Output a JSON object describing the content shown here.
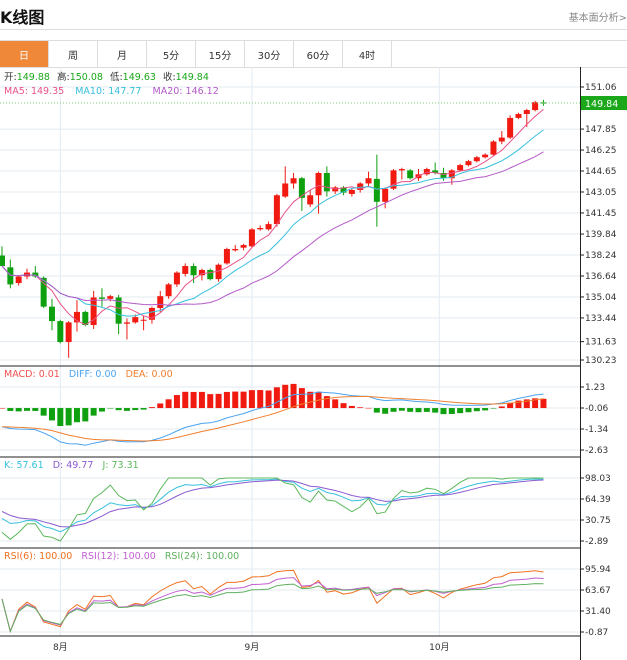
{
  "header": {
    "title": "K线图",
    "fundamental_link": "基本面分析>"
  },
  "tabs": [
    {
      "label": "日",
      "active": true
    },
    {
      "label": "周"
    },
    {
      "label": "月"
    },
    {
      "label": "5分"
    },
    {
      "label": "15分"
    },
    {
      "label": "30分"
    },
    {
      "label": "60分"
    },
    {
      "label": "4时"
    }
  ],
  "ohlc_info": {
    "open_label": "开:",
    "open": "149.88",
    "high_label": "高:",
    "high": "150.08",
    "low_label": "低:",
    "low": "149.63",
    "close_label": "收:",
    "close": "149.84"
  },
  "ma_info": {
    "ma5": "MA5: 149.35",
    "ma10": "MA10: 147.77",
    "ma20": "MA20: 146.12"
  },
  "macd_info": {
    "macd": "MACD: 0.01",
    "diff": "DIFF: 0.00",
    "dea": "DEA: 0.00"
  },
  "kdj_info": {
    "k": "K: 57.61",
    "d": "D: 49.77",
    "j": "J: 73.31"
  },
  "rsi_info": {
    "rsi6": "RSI(6): 100.00",
    "rsi12": "RSI(12): 100.00",
    "rsi24": "RSI(24): 100.00"
  },
  "current_price": "149.84",
  "colors": {
    "up": "#f01a10",
    "down": "#0fa010",
    "accent": "#f0883a",
    "ma5": "#e8528a",
    "ma10": "#37c0dc",
    "ma20": "#b45ac8",
    "diff": "#4aa3f0",
    "dea": "#f08030",
    "macd": "#f05050",
    "k": "#37c0dc",
    "d": "#8a5ad0",
    "j": "#5cb85c",
    "rsi6": "#f07020",
    "rsi12": "#c060d0",
    "rsi24": "#60b060"
  },
  "axes": {
    "price_ticks": [
      "151.06",
      "147.85",
      "146.25",
      "144.65",
      "143.05",
      "141.45",
      "139.84",
      "138.24",
      "136.64",
      "135.04",
      "133.44",
      "131.63",
      "130.23"
    ],
    "price_range": [
      130.23,
      151.06
    ],
    "macd_ticks": [
      "1.23",
      "-0.06",
      "-1.34",
      "-2.63"
    ],
    "macd_range": [
      -2.63,
      1.23
    ],
    "kdj_ticks": [
      "98.03",
      "64.39",
      "30.75",
      "-2.89"
    ],
    "kdj_range": [
      -2.89,
      98.03
    ],
    "rsi_ticks": [
      "95.94",
      "63.67",
      "31.40",
      "-0.87"
    ],
    "rsi_range": [
      -0.87,
      95.94
    ],
    "months": [
      {
        "label": "8月",
        "index": 7
      },
      {
        "label": "9月",
        "index": 30
      },
      {
        "label": "10月",
        "index": 52.5
      }
    ]
  },
  "chart_data": {
    "type": "candlestick",
    "ohlc": [
      [
        138.2,
        138.9,
        137.4,
        137.4
      ],
      [
        137.3,
        137.9,
        135.7,
        136.0
      ],
      [
        136.1,
        136.7,
        135.9,
        136.6
      ],
      [
        136.6,
        137.2,
        136.4,
        136.9
      ],
      [
        136.9,
        137.4,
        136.5,
        136.6
      ],
      [
        136.5,
        136.6,
        134.2,
        134.3
      ],
      [
        134.3,
        134.9,
        132.5,
        133.2
      ],
      [
        133.2,
        133.3,
        131.5,
        131.6
      ],
      [
        131.6,
        133.2,
        130.4,
        133.1
      ],
      [
        133.1,
        134.8,
        132.4,
        133.9
      ],
      [
        133.9,
        134.0,
        132.8,
        132.9
      ],
      [
        132.9,
        135.5,
        132.6,
        135.0
      ],
      [
        135.0,
        135.7,
        134.3,
        134.9
      ],
      [
        134.9,
        135.2,
        134.7,
        135.1
      ],
      [
        135.0,
        135.2,
        132.2,
        133.0
      ],
      [
        133.0,
        133.4,
        131.8,
        133.1
      ],
      [
        133.1,
        133.7,
        133.0,
        133.5
      ],
      [
        133.3,
        133.6,
        132.5,
        133.3
      ],
      [
        133.3,
        134.3,
        133.0,
        134.2
      ],
      [
        134.2,
        135.5,
        133.9,
        135.1
      ],
      [
        135.1,
        136.1,
        134.9,
        136.0
      ],
      [
        136.0,
        137.0,
        135.8,
        136.9
      ],
      [
        136.8,
        137.6,
        136.6,
        137.4
      ],
      [
        137.4,
        137.6,
        136.1,
        136.7
      ],
      [
        136.7,
        137.2,
        136.3,
        137.1
      ],
      [
        137.1,
        137.2,
        136.3,
        136.4
      ],
      [
        136.4,
        137.6,
        136.2,
        137.5
      ],
      [
        137.6,
        138.8,
        137.5,
        138.7
      ],
      [
        138.6,
        139.0,
        138.5,
        138.7
      ],
      [
        138.8,
        139.1,
        138.6,
        139.0
      ],
      [
        138.9,
        140.3,
        138.8,
        140.2
      ],
      [
        140.2,
        140.5,
        140.1,
        140.3
      ],
      [
        140.2,
        140.8,
        140.1,
        140.6
      ],
      [
        140.6,
        142.9,
        140.4,
        142.8
      ],
      [
        142.7,
        145.0,
        142.6,
        143.7
      ],
      [
        143.7,
        144.5,
        143.3,
        144.1
      ],
      [
        144.1,
        144.2,
        141.6,
        142.6
      ],
      [
        142.1,
        143.2,
        141.9,
        142.8
      ],
      [
        142.8,
        144.6,
        141.4,
        144.5
      ],
      [
        144.5,
        145.0,
        142.7,
        143.1
      ],
      [
        143.1,
        143.5,
        142.9,
        143.4
      ],
      [
        143.4,
        143.5,
        142.8,
        143.0
      ],
      [
        142.9,
        143.3,
        142.7,
        143.2
      ],
      [
        143.2,
        143.8,
        143.0,
        143.7
      ],
      [
        143.7,
        144.6,
        143.5,
        144.1
      ],
      [
        144.05,
        145.9,
        140.4,
        142.3
      ],
      [
        142.3,
        143.4,
        141.8,
        143.3
      ],
      [
        143.3,
        144.8,
        143.2,
        144.7
      ],
      [
        144.7,
        144.9,
        144.0,
        144.8
      ],
      [
        144.7,
        144.8,
        144.0,
        144.1
      ],
      [
        144.1,
        144.8,
        143.9,
        144.4
      ],
      [
        144.4,
        144.9,
        144.3,
        144.8
      ],
      [
        144.7,
        145.3,
        144.4,
        144.5
      ],
      [
        144.5,
        144.9,
        143.9,
        144.1
      ],
      [
        144.1,
        144.8,
        143.6,
        144.7
      ],
      [
        144.7,
        145.2,
        144.6,
        145.1
      ],
      [
        145.1,
        145.5,
        145.0,
        145.4
      ],
      [
        145.4,
        145.8,
        145.3,
        145.7
      ],
      [
        145.7,
        146.0,
        145.6,
        145.9
      ],
      [
        145.9,
        147.0,
        145.8,
        146.9
      ],
      [
        146.9,
        147.7,
        146.7,
        147.2
      ],
      [
        147.2,
        148.9,
        147.1,
        148.7
      ],
      [
        148.7,
        149.1,
        148.6,
        149.0
      ],
      [
        149.0,
        149.4,
        148.0,
        149.3
      ],
      [
        149.3,
        150.0,
        149.2,
        149.9
      ],
      [
        149.88,
        150.08,
        149.63,
        149.84
      ]
    ]
  }
}
